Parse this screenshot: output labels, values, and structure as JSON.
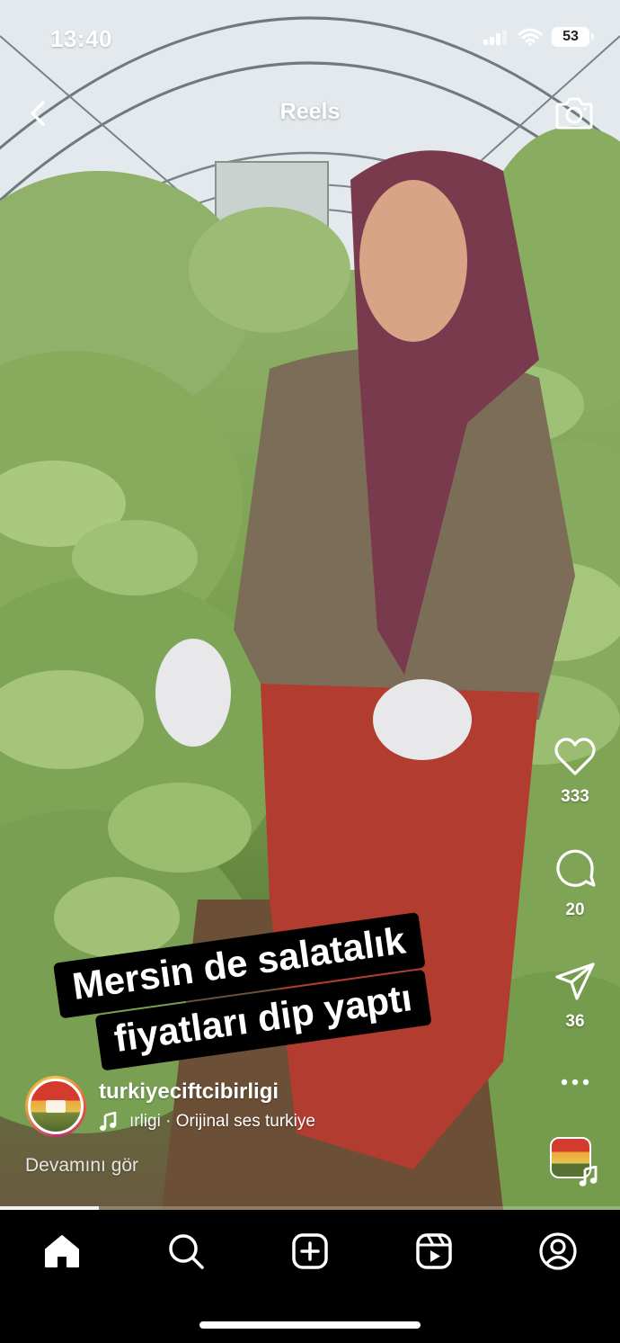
{
  "status_bar": {
    "time": "13:40",
    "battery": "53"
  },
  "header": {
    "title": "Reels"
  },
  "caption_sticker": {
    "line1": "Mersin  de salatalık",
    "line2": "fiyatları dip yaptı"
  },
  "actions": {
    "likes": "333",
    "comments": "20",
    "shares": "36"
  },
  "account": {
    "username": "turkiyeciftcibirligi"
  },
  "audio": {
    "text": "ırligi · Orijinal ses     turkiye"
  },
  "caption": {
    "more_label": "Devamını gör"
  },
  "progress": {
    "fraction": 0.16
  },
  "icons": [
    "back-icon",
    "camera-icon",
    "heart-icon",
    "comment-icon",
    "share-icon",
    "more-icon",
    "music-note-icon",
    "home-icon",
    "search-icon",
    "create-icon",
    "reels-icon",
    "profile-icon"
  ],
  "colors": {
    "nav_background": "#000000",
    "sticker_background": "#000000",
    "text": "#ffffff"
  }
}
